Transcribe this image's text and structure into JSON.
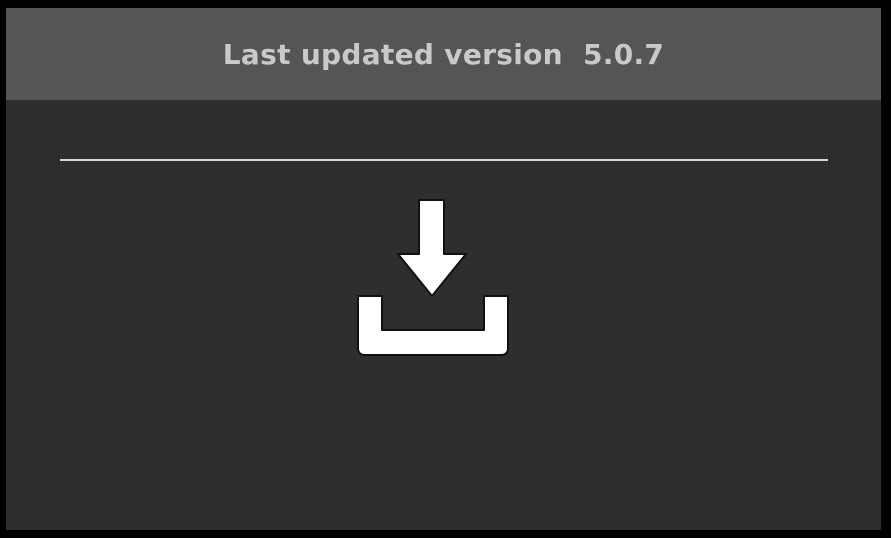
{
  "header": {
    "title": "Last updated version  5.0.7"
  },
  "download": {
    "icon": "download-icon"
  },
  "colors": {
    "outer_background": "#000000",
    "panel_background": "#2e2e2e",
    "header_background": "#555555",
    "header_text": "#c9c9c9",
    "divider": "#d8d8d8",
    "icon_fill": "#ffffff"
  }
}
